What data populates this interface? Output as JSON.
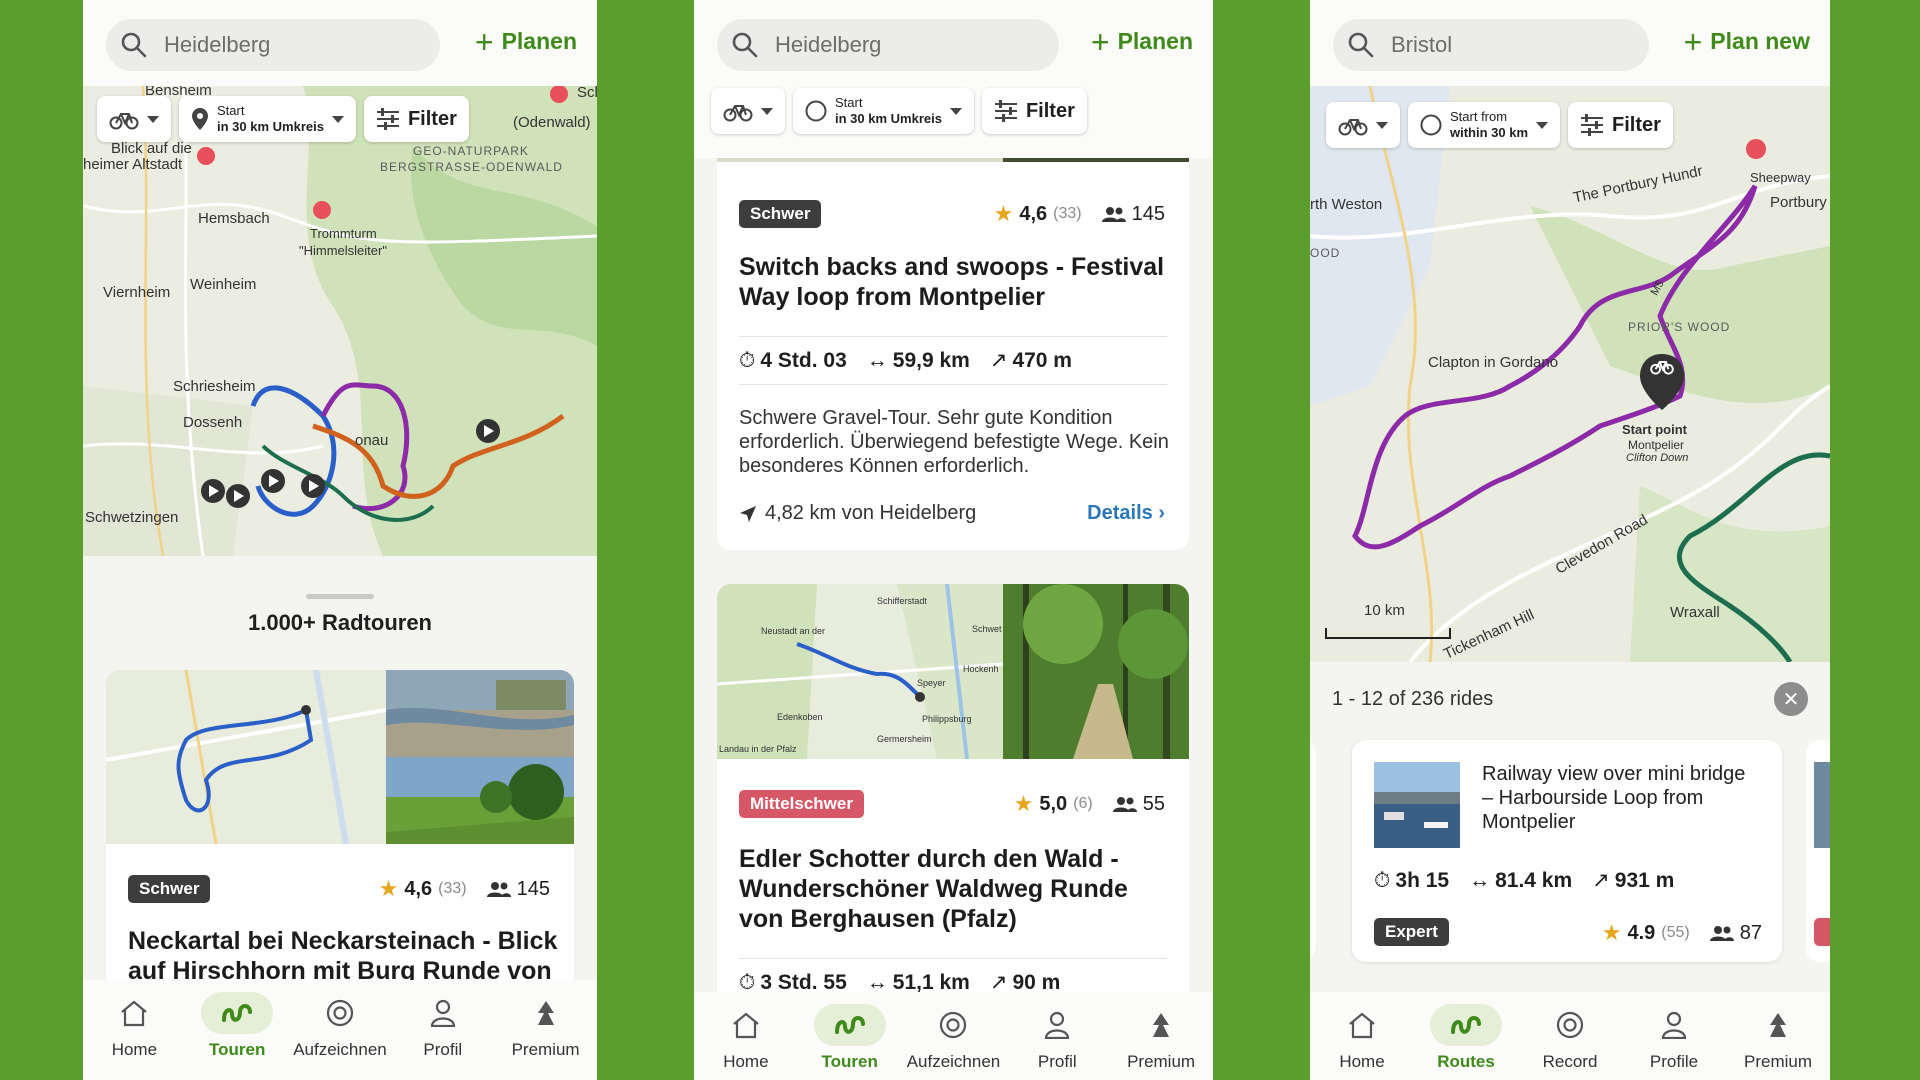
{
  "colors": {
    "accent": "#3f8a1a",
    "background": "#5a9e2c",
    "route_purple": "#8c2aa8",
    "route_orange": "#d1621e",
    "route_blue": "#2a5fc9",
    "route_green": "#1d6e4e"
  },
  "phone1": {
    "search_text": "Heidelberg",
    "plan_label": "Planen",
    "chip_start_line1": "Start",
    "chip_start_line2": "in 30 km Umkreis",
    "chip_filter": "Filter",
    "map_labels": [
      "Bensheim",
      "Blick auf die",
      "heimer Altstadt",
      "Hemsbach",
      "Trommturm",
      "\"Himmelsleiter\"",
      "Viernheim",
      "Weinheim",
      "Schriesheim",
      "Dossenh",
      "Schwetzingen",
      "(Odenwald)",
      "GEO-NATURPARK",
      "BERGSTRASSE-ODENWALD",
      "onau",
      "Sch"
    ],
    "sheet_title": "1.000+ Radtouren",
    "card": {
      "badge": "Schwer",
      "rating": "4,6",
      "rating_count": "(33)",
      "participants": "145",
      "title": "Neckartal bei Neckarsteinach - Blick auf Hirschhorn mit Burg Runde von"
    },
    "nav": [
      {
        "label": "Home",
        "icon": "home-icon",
        "active": false
      },
      {
        "label": "Touren",
        "icon": "routes-icon",
        "active": true
      },
      {
        "label": "Aufzeichnen",
        "icon": "record-icon",
        "active": false
      },
      {
        "label": "Profil",
        "icon": "profile-icon",
        "active": false
      },
      {
        "label": "Premium",
        "icon": "premium-icon",
        "active": false
      }
    ]
  },
  "phone2": {
    "search_text": "Heidelberg",
    "plan_label": "Planen",
    "chip_start_line1": "Start",
    "chip_start_line2": "in 30 km Umkreis",
    "chip_filter": "Filter",
    "card1": {
      "badge": "Schwer",
      "rating": "4,6",
      "rating_count": "(33)",
      "participants": "145",
      "title": "Switch backs and swoops - Festival Way loop from Montpelier",
      "duration": "4 Std. 03",
      "distance": "59,9 km",
      "elevation": "470 m",
      "description": "Schwere Gravel-Tour. Sehr gute Kondition erforderlich. Überwiegend befestigte Wege. Kein besonderes Können erforderlich.",
      "distance_from": "4,82 km von Heidelberg",
      "details_label": "Details"
    },
    "card2": {
      "badge": "Mittelschwer",
      "rating": "5,0",
      "rating_count": "(6)",
      "participants": "55",
      "title": "Edler Schotter durch den Wald - Wunderschöner Waldweg Runde von Berghausen (Pfalz)",
      "duration": "3 Std. 55",
      "distance": "51,1 km",
      "elevation": "90 m",
      "map_labels": [
        "Neustadt an der",
        "Edenkoben",
        "Speyer",
        "Landau in der Pfalz",
        "Germersheim",
        "Philippsburg",
        "Hockenh",
        "Schifferstadt",
        "Schwet"
      ]
    },
    "nav": [
      {
        "label": "Home",
        "icon": "home-icon",
        "active": false
      },
      {
        "label": "Touren",
        "icon": "routes-icon",
        "active": true
      },
      {
        "label": "Aufzeichnen",
        "icon": "record-icon",
        "active": false
      },
      {
        "label": "Profil",
        "icon": "profile-icon",
        "active": false
      },
      {
        "label": "Premium",
        "icon": "premium-icon",
        "active": false
      }
    ]
  },
  "phone3": {
    "search_text": "Bristol",
    "plan_label": "Plan new",
    "chip_start_line1": "Start from",
    "chip_start_line2": "within 30 km",
    "chip_filter": "Filter",
    "map_labels": [
      "rth Weston",
      "The Portbury Hundr",
      "Sheepway",
      "Portbury",
      "PRIOR'S WOOD",
      "Clapton in Gordano",
      "Start point",
      "Montpelier",
      "Clifton Down",
      "Clevedon Road",
      "Wraxall",
      "10 km",
      "Tickenham Hill",
      "OOD",
      "M5"
    ],
    "result_count": "1 - 12 of 236 rides",
    "card": {
      "title": "Railway view over mini bridge – Harbourside Loop from Montpelier",
      "duration": "3h 15",
      "distance": "81.4 km",
      "elevation": "931 m",
      "badge": "Expert",
      "rating": "4.9",
      "rating_count": "(55)",
      "participants": "87"
    },
    "nav": [
      {
        "label": "Home",
        "icon": "home-icon",
        "active": false
      },
      {
        "label": "Routes",
        "icon": "routes-icon",
        "active": true
      },
      {
        "label": "Record",
        "icon": "record-icon",
        "active": false
      },
      {
        "label": "Profile",
        "icon": "profile-icon",
        "active": false
      },
      {
        "label": "Premium",
        "icon": "premium-icon",
        "active": false
      }
    ]
  }
}
